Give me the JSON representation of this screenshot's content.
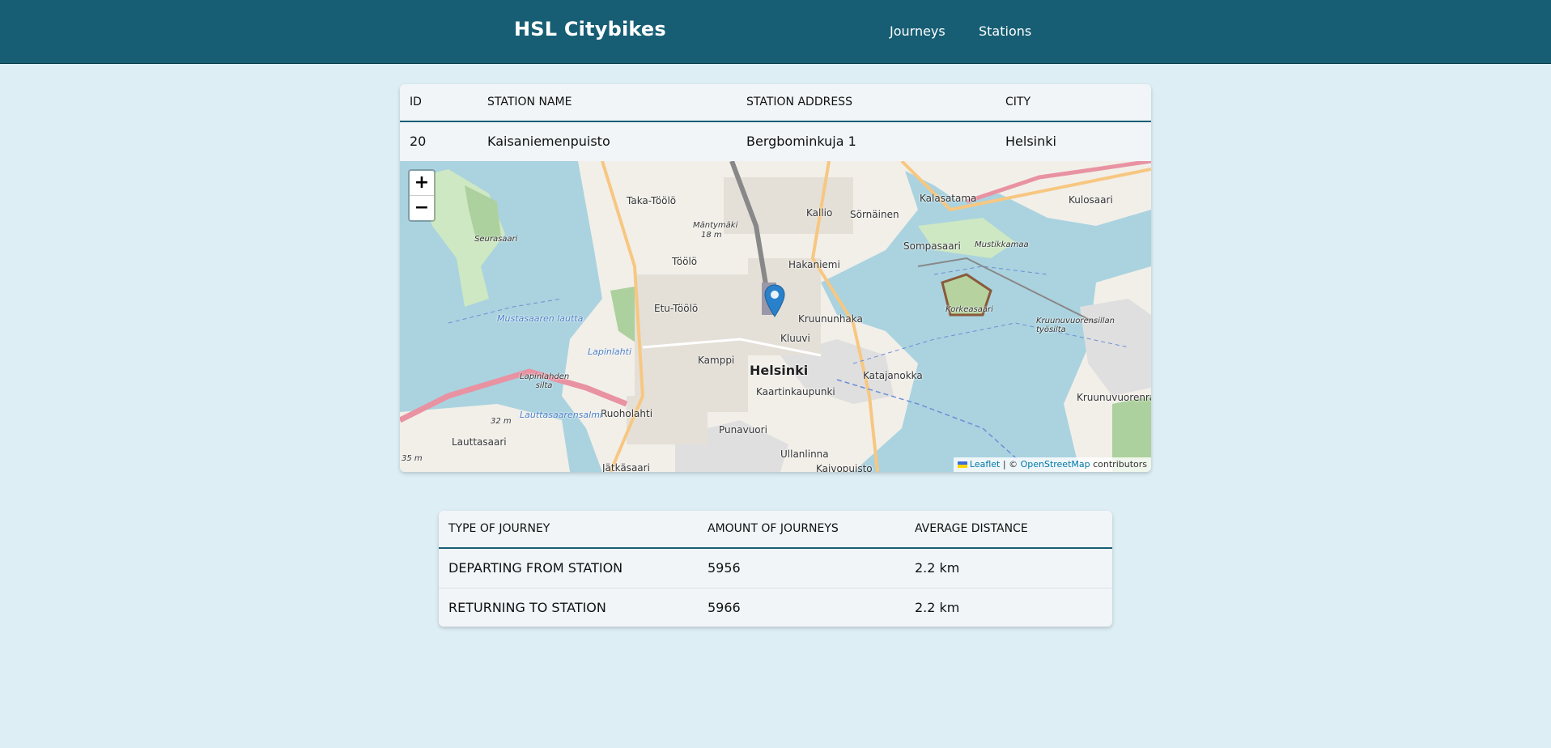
{
  "navbar": {
    "brand": "HSL Citybikes",
    "links": [
      "Journeys",
      "Stations"
    ]
  },
  "station_table": {
    "headers": [
      "ID",
      "STATION NAME",
      "STATION ADDRESS",
      "CITY"
    ],
    "row": {
      "id": "20",
      "name": "Kaisaniemenpuisto",
      "address": "Bergbominkuja 1",
      "city": "Helsinki"
    }
  },
  "map": {
    "zoom_in": "+",
    "zoom_out": "−",
    "attribution": {
      "leaflet": "Leaflet",
      "separator": " | © ",
      "osm": "OpenStreetMap",
      "suffix": " contributors"
    },
    "place_labels": {
      "taka_toolo": "Taka-Töölö",
      "kallio": "Kallio",
      "sornainen": "Sörnäinen",
      "kalasatama": "Kalasatama",
      "kulosaari": "Kulosaari",
      "seurasaari": "Seurasaari",
      "mantymaki": "Mäntymäki",
      "mantymaki_elev": "18 m",
      "toolo": "Töölö",
      "hakaniemi": "Hakaniemi",
      "sompasaari": "Sompasaari",
      "mustikkamaa": "Mustikkamaa",
      "korkeasaari": "Korkeasaari",
      "etu_toolo": "Etu-Töölö",
      "kruununhaka": "Kruununhaka",
      "kluuvi": "Kluuvi",
      "mustasaari_lautta": "Mustasaaren lautta",
      "lapinlahti": "Lapinlahti",
      "kamppi": "Kamppi",
      "helsinki": "Helsinki",
      "katajanokka": "Katajanokka",
      "kaartinkaupunki": "Kaartinkaupunki",
      "lapinlahden_silta": "Lapinlahden silta",
      "ruoholahti": "Ruoholahti",
      "punavuori": "Punavuori",
      "ullanlinna": "Ullanlinna",
      "lauttasaari": "Lauttasaari",
      "jatkasaari": "Jätkäsaari",
      "kruunuvuorensillan": "Kruunuvuorensillan työsilta",
      "kruunuvuorenranta": "Kruunuvuorenra",
      "kaivopuisto": "Kaivopuisto",
      "lauttasaarensalmi": "Lauttasaarensalmi",
      "elev_32": "32 m",
      "elev_35": "35 m"
    }
  },
  "journey_summary": {
    "headers": [
      "TYPE OF JOURNEY",
      "AMOUNT OF JOURNEYS",
      "AVERAGE DISTANCE"
    ],
    "rows": [
      {
        "type": "DEPARTING FROM STATION",
        "amount": "5956",
        "distance": "2.2 km"
      },
      {
        "type": "RETURNING TO STATION",
        "amount": "5966",
        "distance": "2.2 km"
      }
    ]
  },
  "colors": {
    "navbar": "#175e74",
    "background": "#ddeef5",
    "card": "#f1f5f8",
    "water": "#aad3df",
    "marker": "#2a81cb"
  }
}
